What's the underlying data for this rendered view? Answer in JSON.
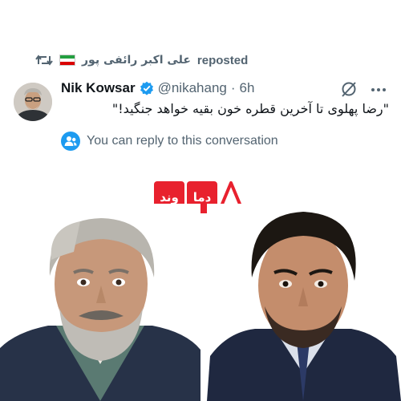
{
  "repost": {
    "icon": "repost-icon",
    "reposter_name": "علی اکبر رائفی پور",
    "flag": "iran-flag",
    "label": "reposted"
  },
  "tweet": {
    "author_name": "Nik Kowsar",
    "verified_icon": "verified-badge-icon",
    "handle": "@nikahang",
    "separator": "·",
    "time": "6h",
    "text": "\"رضا پهلوی تا آخرین قطره خون بقیه خواهد جنگید!\""
  },
  "reply": {
    "icon": "people-icon",
    "text": "You can reply to this conversation"
  },
  "media": {
    "logo_box_1": "دما",
    "logo_box_2": "وند",
    "logo_icon": "triangle-outline-icon"
  },
  "colors": {
    "accent_blue": "#1d9bf0",
    "muted_text": "#536471",
    "logo_red": "#e8212e"
  }
}
